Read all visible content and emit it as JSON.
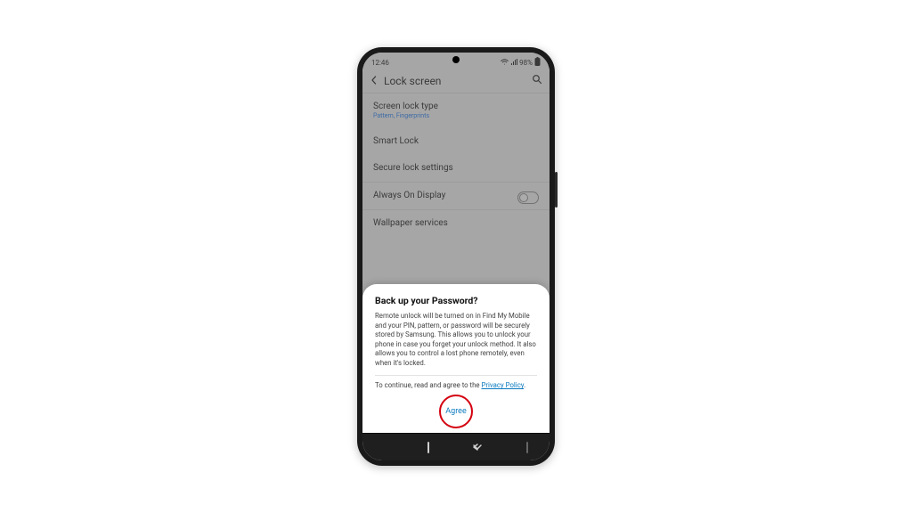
{
  "statusbar": {
    "time": "12:46",
    "battery": "98%"
  },
  "appbar": {
    "title": "Lock screen"
  },
  "rows": {
    "screen_lock": {
      "title": "Screen lock type",
      "subtitle": "Pattern, Fingerprints"
    },
    "smart_lock": {
      "title": "Smart Lock"
    },
    "secure_lock": {
      "title": "Secure lock settings"
    },
    "aod": {
      "title": "Always On Display"
    },
    "wallpaper": {
      "title": "Wallpaper services"
    }
  },
  "sheet": {
    "title": "Back up your Password?",
    "body": "Remote unlock will be turned on in Find My Mobile and your PIN, pattern, or password will be securely stored by Samsung. This allows you to unlock your phone in case you forget your unlock method. It also allows you to control a lost phone remotely, even when it's locked.",
    "consent_prefix": "To continue, read and agree to the ",
    "privacy_link": "Privacy Policy",
    "consent_suffix": ".",
    "agree": "Agree"
  }
}
